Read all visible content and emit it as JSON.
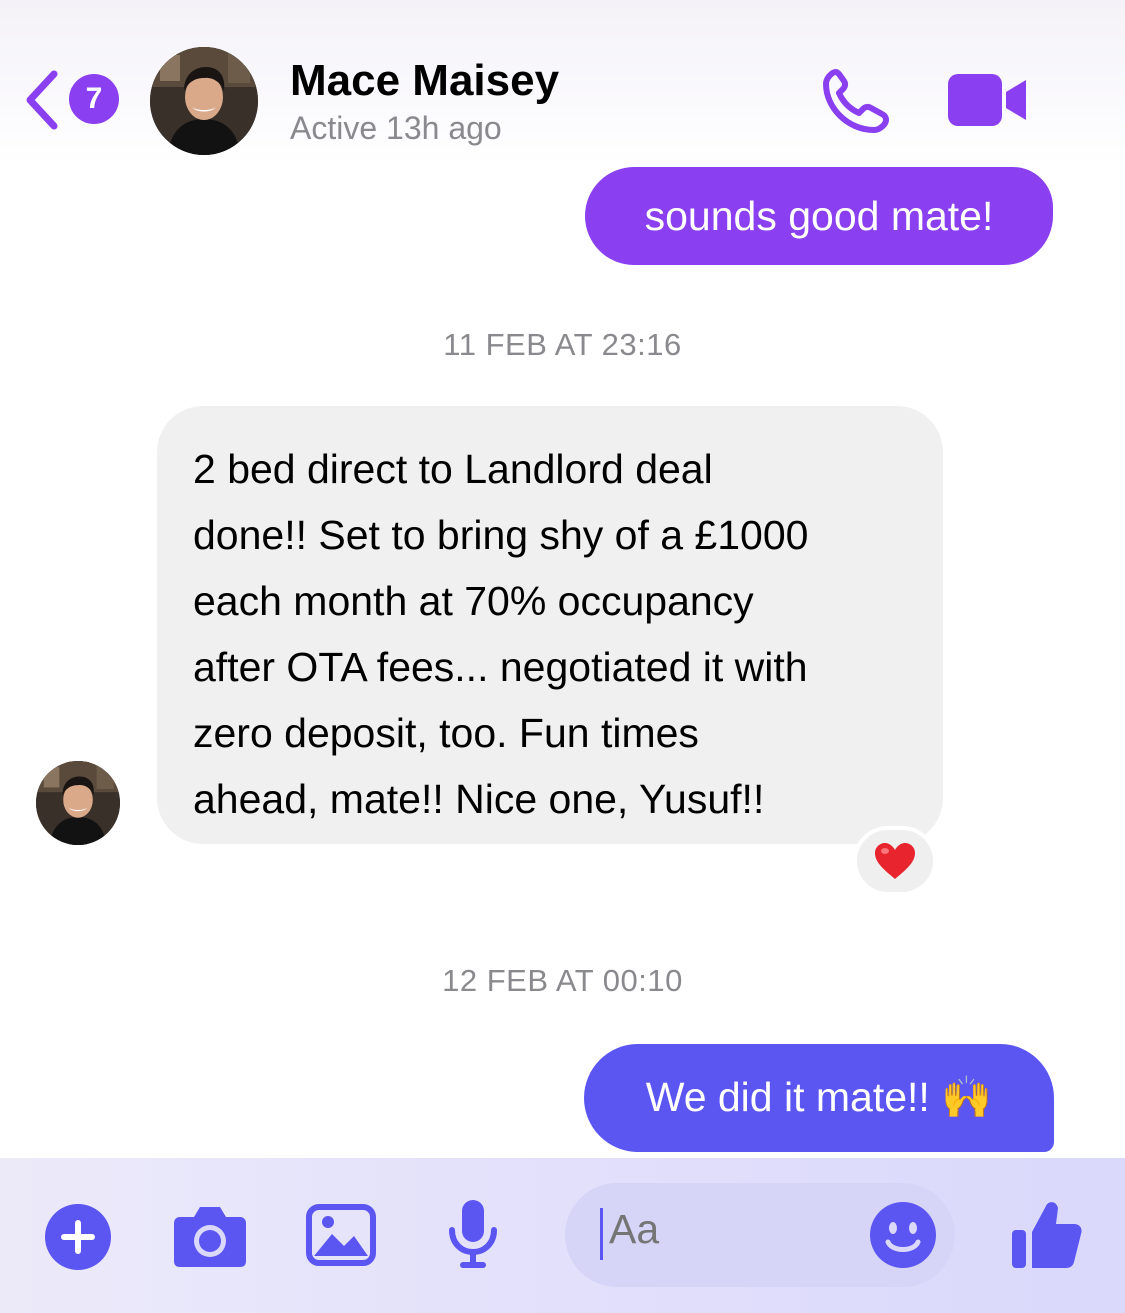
{
  "colors": {
    "accent_purple": "#8a3ff0",
    "accent_blue": "#5b55f2",
    "incoming_bubble": "#f0f0f0",
    "muted_text": "#8a8a8e",
    "heart": "#e8242e"
  },
  "header": {
    "back_badge": "7",
    "contact_name": "Mace Maisey",
    "status": "Active 13h ago",
    "icons": [
      "back-chevron-icon",
      "phone-icon",
      "video-camera-icon"
    ]
  },
  "messages": [
    {
      "kind": "outgoing",
      "text": "sounds good mate!"
    },
    {
      "kind": "timestamp",
      "text": "11 FEB AT 23:16"
    },
    {
      "kind": "incoming",
      "text": "2 bed direct to Landlord deal\ndone!! Set to bring shy of a £1000\neach month at 70% occupancy\nafter OTA fees...  negotiated it with\nzero deposit, too. Fun times\nahead, mate!! Nice one, Yusuf!!",
      "reaction": "❤️"
    },
    {
      "kind": "timestamp",
      "text": "12 FEB AT 00:10"
    },
    {
      "kind": "outgoing",
      "text": "We did it mate!! 🙌"
    }
  ],
  "composer": {
    "placeholder": "Aa",
    "icons": [
      "plus-icon",
      "camera-icon",
      "gallery-icon",
      "microphone-icon",
      "emoji-icon",
      "thumbs-up-icon"
    ]
  }
}
